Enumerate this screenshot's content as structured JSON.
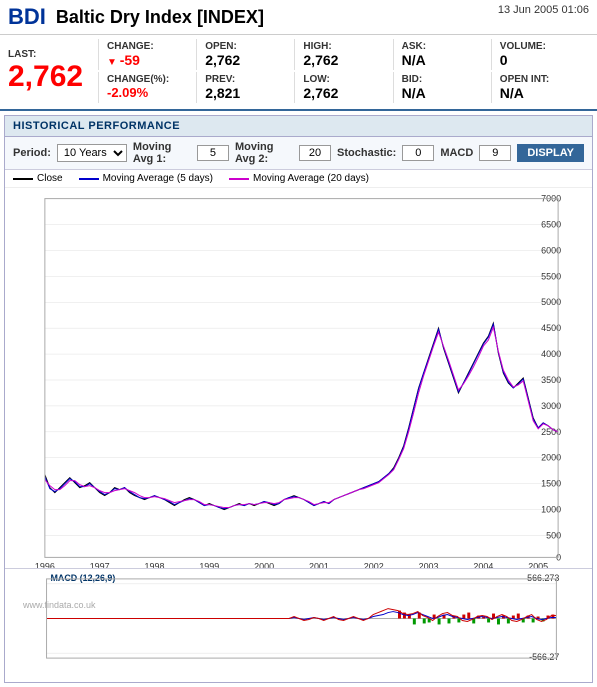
{
  "header": {
    "ticker": "BDI",
    "name": "Baltic Dry Index [INDEX]",
    "date": "13 Jun 2005 01:06"
  },
  "stats": {
    "last_label": "LAST:",
    "last_value": "2,762",
    "change_label": "CHANGE:",
    "change_value": "-59",
    "change_negative": true,
    "open_label": "OPEN:",
    "open_value": "2,762",
    "high_label": "HIGH:",
    "high_value": "2,762",
    "ask_label": "ASK:",
    "ask_value": "N/A",
    "volume_label": "VOLUME:",
    "volume_value": "0",
    "change_pct_label": "CHANGE(%):",
    "change_pct_value": "-2.09%",
    "prev_label": "PREV:",
    "prev_value": "2,821",
    "low_label": "LOW:",
    "low_value": "2,762",
    "bid_label": "BID:",
    "bid_value": "N/A",
    "open_int_label": "OPEN INT:",
    "open_int_value": "N/A"
  },
  "historical": {
    "section_title": "HISTORICAL PERFORMANCE",
    "period_label": "Period:",
    "period_value": "10 Years",
    "ma1_label": "Moving Avg 1:",
    "ma1_value": "5",
    "ma2_label": "Moving Avg 2:",
    "ma2_value": "20",
    "stochastic_label": "Stochastic:",
    "stochastic_value": "0",
    "macd_label": "MACD",
    "macd_value": "9",
    "display_button": "DISPLAY",
    "legend": {
      "close_label": "Close",
      "ma5_label": "Moving Average (5 days)",
      "ma20_label": "Moving Average (20 days)"
    },
    "y_axis_max": "7000",
    "y_axis_labels": [
      "7000",
      "6500",
      "6000",
      "5500",
      "5000",
      "4500",
      "4000",
      "3500",
      "3000",
      "2500",
      "2000",
      "1500",
      "1000",
      "500",
      "0"
    ],
    "x_axis_labels": [
      "1996",
      "1997",
      "1998",
      "1999",
      "2000",
      "2001",
      "2002",
      "2003",
      "2004",
      "2005"
    ],
    "macd_label_chart": "MACD (12,26,9)",
    "macd_top": "566.273",
    "macd_bottom": "-566.27",
    "watermark": "www.findata.co.uk"
  }
}
